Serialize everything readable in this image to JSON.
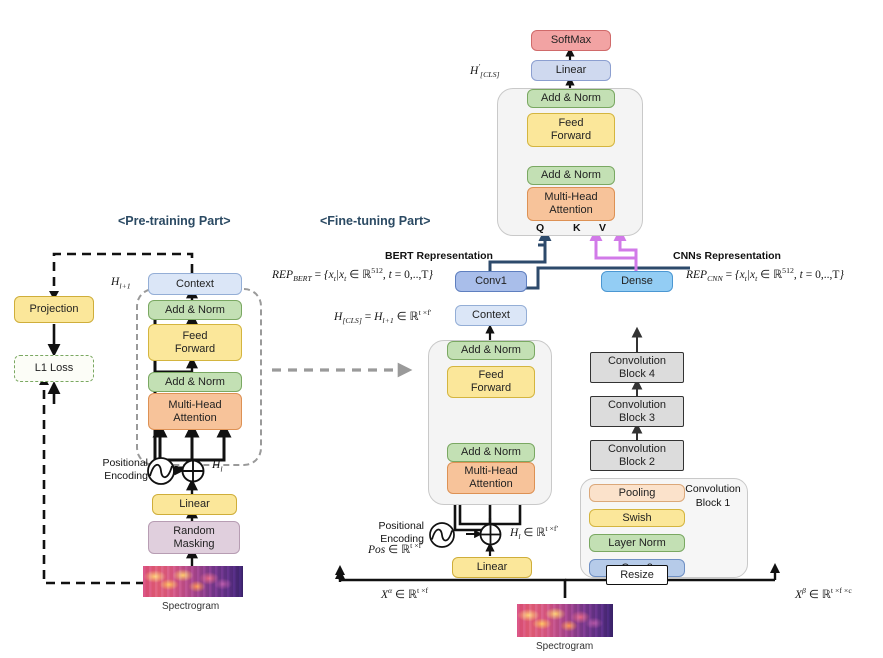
{
  "sections": {
    "pretraining_title": "<Pre-training Part>",
    "finetuning_title": "<Fine-tuning Part>"
  },
  "labels": {
    "bert_representation": "BERT Representation",
    "cnns_representation": "CNNs Representation",
    "spectrogram_left": "Spectrogram",
    "spectrogram_bottom": "Spectrogram",
    "positional_encoding": "Positional\nEncoding",
    "convolution_block_1_label": "Convolution\nBlock 1",
    "q": "Q",
    "k": "K",
    "v": "V"
  },
  "pretraining": {
    "projection": "Projection",
    "l1_loss": "L1 Loss",
    "context": "Context",
    "add_norm_top": "Add & Norm",
    "feed_forward": "Feed\nForward",
    "add_norm_bottom": "Add & Norm",
    "multi_head_attention": "Multi-Head\nAttention",
    "linear": "Linear",
    "random_masking": "Random\nMasking",
    "h_l_plus_1": "H",
    "h_l": "H"
  },
  "finetuning": {
    "softmax": "SoftMax",
    "linear_top": "Linear",
    "add_norm_top_upper": "Add & Norm",
    "feed_forward_upper": "Feed\nForward",
    "add_norm_bottom_upper": "Add & Norm",
    "multi_head_attention_upper": "Multi-Head\nAttention",
    "conv1": "Conv1",
    "context": "Context",
    "add_norm_top_lower": "Add & Norm",
    "feed_forward_lower": "Feed\nForward",
    "add_norm_bottom_lower": "Add & Norm",
    "multi_head_attention_lower": "Multi-Head\nAttention",
    "linear_bottom": "Linear"
  },
  "cnn_branch": {
    "dense": "Dense",
    "block4": "Convolution\nBlock 4",
    "block3": "Convolution\nBlock 3",
    "block2": "Convolution\nBlock 2",
    "pooling": "Pooling",
    "swish": "Swish",
    "layer_norm": "Layer Norm",
    "conv2": "Conv2",
    "resize": "Resize"
  },
  "math": {
    "rep_bert": "REP_BERT = {x_t | x_t ∈ R^512, t = 0,..,T}",
    "rep_cnn": "REP_CNN = {x_t | x_t ∈ R^512, t = 0,..,T}",
    "h_cls_eq": "H_[CLS] = H_l+1 ∈ R^(t × f')",
    "h_l_ft": "H_l ∈ R^(t × f')",
    "pos_eq": "Pos ∈ R^(t × f')",
    "x_alpha": "X^α ∈ R^(t × f)",
    "x_beta": "X^β ∈ R^(t × f × c)",
    "h_cls_prime": "H'_[CLS]",
    "h_l_plus_1_pre": "H_l+1",
    "h_l_pre": "H_l"
  },
  "colors": {
    "softmax": "#f2a3a3",
    "add_norm": "#c3e0b4",
    "feed_forward": "#fbe79a",
    "multi_head_attention": "#f7c39a",
    "context": "#dbe6f7",
    "conv1": "#a9beea",
    "dense": "#93cdf4",
    "conv_block": "#dcdcdc",
    "pooling": "#fbe2cb",
    "random_masking": "#e0cfdd",
    "q_arrow": "#2d4a6b",
    "kv_arrow": "#d17ae8",
    "section_title": "#2b4a63"
  }
}
